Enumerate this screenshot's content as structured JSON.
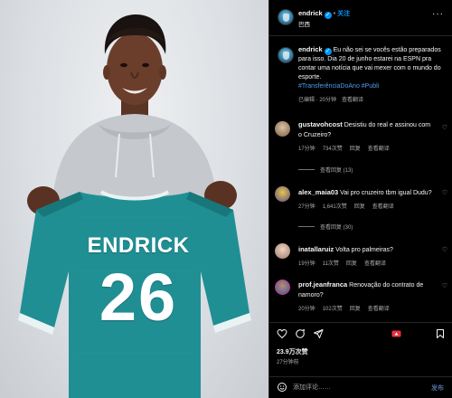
{
  "post_image": {
    "jersey_name": "ENDRICK",
    "jersey_number": "26"
  },
  "header": {
    "username": "endrick",
    "follow_label": "关注",
    "separator": "•",
    "location": "巴西",
    "more_label": "···"
  },
  "caption": {
    "username": "endrick",
    "text": "Eu não sei se vocês estão preparados para isso. Dia 20 de junho estarei na ESPN pra contar uma notícia que vai mexer com o mundo do esporte.",
    "hashtags": "#TransferênciaDoAno #Publi",
    "edited": "已编辑 · 20分钟",
    "translate": "查看翻译"
  },
  "comments": [
    {
      "username": "gustavohcost",
      "text": "Desistiu do real e assinou com o Cruzeiro?",
      "time": "17分钟",
      "likes": "734次赞",
      "reply": "回复",
      "translate": "查看翻译",
      "view_replies": "查看回复 (13)"
    },
    {
      "username": "alex_maia03",
      "text": "Vai pro cruzeiro tbm igual Dudu?",
      "time": "27分钟",
      "likes": "1,641次赞",
      "reply": "回复",
      "translate": "查看翻译",
      "view_replies": "查看回复 (30)"
    },
    {
      "username": "inatallaruiz",
      "text": "Volta pro palmeiras?",
      "time": "19分钟",
      "likes": "11次赞",
      "reply": "回复",
      "translate": "查看翻译",
      "view_replies": ""
    },
    {
      "username": "prof.jeanfranca",
      "text": "Renovação do contrato de namoro?",
      "time": "20分钟",
      "likes": "102次赞",
      "reply": "回复",
      "translate": "查看翻译",
      "view_replies": ""
    }
  ],
  "actions": {
    "likes": "23.9万次赞",
    "time": "27分钟前",
    "icons": [
      "heart-icon",
      "comment-icon",
      "share-icon",
      "save-icon"
    ]
  },
  "comment_box": {
    "placeholder": "添加评论……",
    "post_label": "发布"
  },
  "colors": {
    "accent": "#0095f6",
    "hashtag": "#4f9df0",
    "muted": "#a8a8a8",
    "jersey": "#1f8f94"
  }
}
